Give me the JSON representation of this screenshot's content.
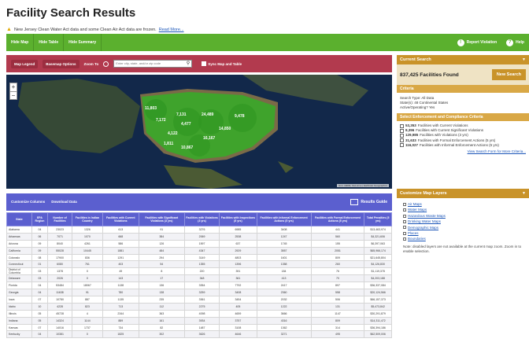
{
  "page": {
    "title": "Facility Search Results",
    "notice": "New Jersey Clean Water Act data and some Clean Air Act data are frozen.",
    "notice_link": "Read More..."
  },
  "topbar": {
    "buttons": [
      "Hide Map",
      "Hide Table",
      "Hide Summary"
    ],
    "report_violation": "Report Violation",
    "help": "Help"
  },
  "map_tools": {
    "legend": "Map Legend",
    "basemap": "Basemap Options",
    "zoom_to": "Zoom To",
    "search_placeholder": "Enter city, state, and/or zip code",
    "sync": "Sync Map and Table"
  },
  "map": {
    "cluster_counts": [
      "11,803",
      "7,172",
      "4,122",
      "4,477",
      "7,131",
      "24,489",
      "14,850",
      "9,478",
      "10,867",
      "16,167",
      "1,811"
    ],
    "attribution": "Esri, HERE, DeLorme | Earthstar Geographics"
  },
  "table_bar": {
    "customize": "Customize Columns",
    "download": "Download Data",
    "results_guide": "Results Guide"
  },
  "table": {
    "headers": [
      "State",
      "EPA Region",
      "Number of Facilities",
      "Facilities in Indian Country",
      "Facilities with Current Violations",
      "Facilities with Significant Violations (3 yrs)",
      "Facilities with Violations (3 yrs)",
      "Facilities with Inspections (5 yrs)",
      "Facilities with Informal Enforcement Actions (5 yrs)",
      "Facilities with Formal Enforcement Actions (5 yrs)",
      "Total Penalties (5 yrs)"
    ],
    "rows": [
      [
        "Alabama",
        "04",
        "23023",
        "1326",
        "613",
        "91",
        "3276",
        "6985",
        "3408",
        "441",
        "$13,463,974"
      ],
      [
        "Arkansas",
        "06",
        "7071",
        "1070",
        "668",
        "384",
        "2069",
        "2538",
        "1247",
        "560",
        "$4,321,606"
      ],
      [
        "Arizona",
        "09",
        "8040",
        "4261",
        "586",
        "126",
        "1597",
        "637",
        "1745",
        "155",
        "$6,397,063"
      ],
      [
        "California",
        "09",
        "55028",
        "10445",
        "1881",
        "484",
        "4347",
        "2929",
        "3557",
        "2051",
        "$65,966,174"
      ],
      [
        "Colorado",
        "08",
        "17900",
        "836",
        "1291",
        "294",
        "3149",
        "4803",
        "1601",
        "809",
        "$21,645,804"
      ],
      [
        "Connecticut",
        "01",
        "6080",
        "761",
        "403",
        "54",
        "1355",
        "1396",
        "1358",
        "260",
        "$4,126,830"
      ],
      [
        "District of Columbia",
        "03",
        "1378",
        "0",
        "49",
        "8",
        "220",
        "391",
        "184",
        "76",
        "$1,119,378"
      ],
      [
        "Delaware",
        "03",
        "2026",
        "0",
        "143",
        "17",
        "348",
        "361",
        "413",
        "70",
        "$4,203,188"
      ],
      [
        "Florida",
        "04",
        "53484",
        "18067",
        "1138",
        "136",
        "3354",
        "7792",
        "2417",
        "897",
        "$36,337,084"
      ],
      [
        "Georgia",
        "04",
        "11638",
        "91",
        "780",
        "138",
        "3259",
        "3408",
        "2360",
        "558",
        "$20,124,566"
      ],
      [
        "Iowa",
        "07",
        "10780",
        "887",
        "1135",
        "235",
        "3361",
        "3454",
        "2032",
        "506",
        "$66,157,373"
      ],
      [
        "Idaho",
        "10",
        "4228",
        "823",
        "713",
        "112",
        "2275",
        "405",
        "1222",
        "131",
        "$5,473,842"
      ],
      [
        "Illinois",
        "05",
        "45728",
        "4",
        "2344",
        "363",
        "4098",
        "4659",
        "3666",
        "1147",
        "$30,291,879"
      ],
      [
        "Indiana",
        "05",
        "14324",
        "1144",
        "889",
        "161",
        "3934",
        "3757",
        "4316",
        "809",
        "$14,311,472"
      ],
      [
        "Kansas",
        "07",
        "14016",
        "1737",
        "734",
        "82",
        "1487",
        "3108",
        "1362",
        "314",
        "$36,394,186"
      ],
      [
        "Kentucky",
        "04",
        "10381",
        "0",
        "1825",
        "302",
        "3626",
        "4646",
        "3271",
        "495",
        "$62,509,006"
      ]
    ]
  },
  "current_search": {
    "header": "Current Search",
    "found": "837,425 Facilities Found",
    "new_search": "New Search",
    "criteria_label": "Criteria",
    "criteria": [
      "Search Type: All Data",
      "State(s): 48 Continental States",
      "Active/Operating? Yes"
    ],
    "ec_header": "Select Enforcement and Compliance Criteria",
    "ec_items": [
      {
        "count": "53,353",
        "label": "Facilities with Current Violations"
      },
      {
        "count": "8,396",
        "label": "Facilities with Current Significant Violations"
      },
      {
        "count": "129,985",
        "label": "Facilities with Violations (3 yrs)"
      },
      {
        "count": "31,633",
        "label": "Facilities with Formal Enforcement Actions (5 yrs)"
      },
      {
        "count": "116,027",
        "label": "Facilities with Informal Enforcement Actions (5 yrs)"
      }
    ],
    "more_link": "View Search Form for More Criteria..."
  },
  "map_layers": {
    "header": "Customize Map Layers",
    "items": [
      "Air Maps",
      "Water Maps",
      "Hazardous Waste Maps",
      "Drinking Water Maps",
      "Demographic Maps",
      "Places",
      "Boundaries"
    ],
    "note": "Note: disabled layers are not available at the current map zoom. Zoom in to enable selection."
  },
  "colors": {
    "green": "#5bb02e",
    "crimson": "#b23a4e",
    "indigo": "#5b5fcf",
    "gold": "#c9932a"
  }
}
